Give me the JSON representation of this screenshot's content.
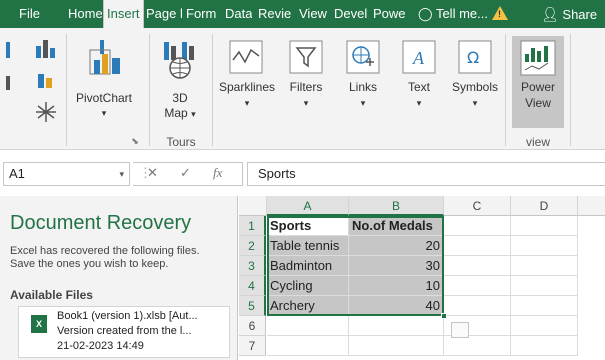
{
  "tabs": [
    "File",
    "Home",
    "Insert",
    "Page l",
    "Form",
    "Data",
    "Revie",
    "View",
    "Devel",
    "Powe"
  ],
  "active_tab": "Insert",
  "tell_me": "Tell me...",
  "share_label": "Share",
  "ribbon": {
    "pivotchart": "PivotChart",
    "map3d_line1": "3D",
    "map3d_line2": "Map",
    "tours_group": "Tours",
    "sparklines": "Sparklines",
    "filters": "Filters",
    "links": "Links",
    "text": "Text",
    "symbols": "Symbols",
    "power_view_line1": "Power",
    "power_view_line2": "View",
    "view_group": "view"
  },
  "formula_bar": {
    "name_box": "A1",
    "fx": "fx",
    "content": "Sports"
  },
  "recovery": {
    "title": "Document Recovery",
    "desc_line1": "Excel has recovered the following files.",
    "desc_line2": "Save the ones you wish to keep.",
    "available_files": "Available Files",
    "file_name": "Book1 (version 1).xlsb  [Aut...",
    "file_desc": "Version created from the l...",
    "file_date": "21-02-2023 14:49"
  },
  "sheet": {
    "columns": [
      "A",
      "B",
      "C",
      "D"
    ],
    "rows": [
      "1",
      "2",
      "3",
      "4",
      "5",
      "6",
      "7"
    ],
    "header": [
      "Sports",
      "No.of Medals"
    ],
    "data": [
      [
        "Table tennis",
        "20"
      ],
      [
        "Badminton",
        "30"
      ],
      [
        "Cycling",
        "10"
      ],
      [
        "Archery",
        "40"
      ]
    ]
  }
}
